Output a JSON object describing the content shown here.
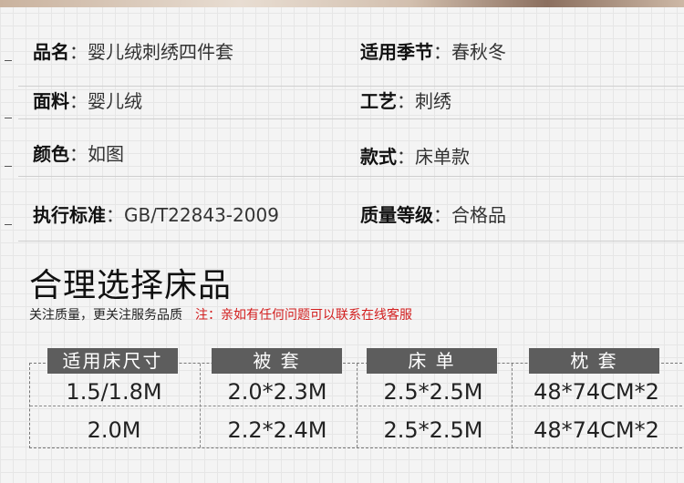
{
  "specs": [
    {
      "left_label": "品名",
      "left_value": "婴儿绒刺绣四件套",
      "right_label": "适用季节",
      "right_value": "春秋冬"
    },
    {
      "left_label": "面料",
      "left_value": "婴儿绒",
      "right_label": "工艺",
      "right_value": "刺绣"
    },
    {
      "left_label": "颜色",
      "left_value": "如图",
      "right_label": "款式",
      "right_value": "床单款"
    },
    {
      "left_label": "执行标准",
      "left_value": "GB/T22843-2009",
      "right_label": "质量等级",
      "right_value": "合格品"
    }
  ],
  "separator": "：",
  "heading": "合理选择床品",
  "subnote": {
    "text": "关注质量，更关注服务品质",
    "warning": "注：亲如有任何问题可以联系在线客服",
    "warning_color": "#d21e1e"
  },
  "size_table": {
    "headers": [
      "适用床尺寸",
      "被 套",
      "床 单",
      "枕 套"
    ],
    "rows": [
      [
        "1.5/1.8M",
        "2.0*2.3M",
        "2.5*2.5M",
        "48*74CM*2"
      ],
      [
        "2.0M",
        "2.2*2.4M",
        "2.5*2.5M",
        "48*74CM*2"
      ]
    ],
    "header_color": "#5d5d5d"
  }
}
